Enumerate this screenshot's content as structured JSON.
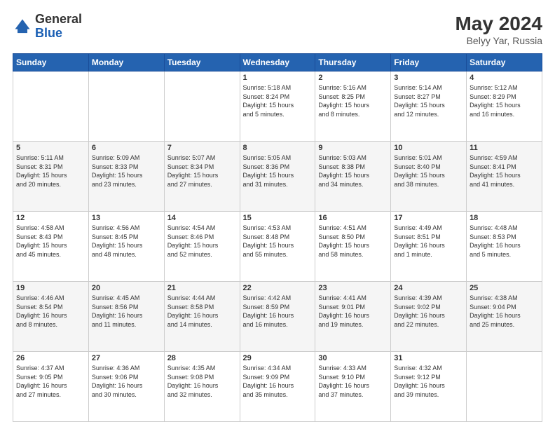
{
  "header": {
    "logo_general": "General",
    "logo_blue": "Blue",
    "month_year": "May 2024",
    "location": "Belyy Yar, Russia"
  },
  "days_of_week": [
    "Sunday",
    "Monday",
    "Tuesday",
    "Wednesday",
    "Thursday",
    "Friday",
    "Saturday"
  ],
  "weeks": [
    [
      {
        "day": "",
        "info": ""
      },
      {
        "day": "",
        "info": ""
      },
      {
        "day": "",
        "info": ""
      },
      {
        "day": "1",
        "info": "Sunrise: 5:18 AM\nSunset: 8:24 PM\nDaylight: 15 hours\nand 5 minutes."
      },
      {
        "day": "2",
        "info": "Sunrise: 5:16 AM\nSunset: 8:25 PM\nDaylight: 15 hours\nand 8 minutes."
      },
      {
        "day": "3",
        "info": "Sunrise: 5:14 AM\nSunset: 8:27 PM\nDaylight: 15 hours\nand 12 minutes."
      },
      {
        "day": "4",
        "info": "Sunrise: 5:12 AM\nSunset: 8:29 PM\nDaylight: 15 hours\nand 16 minutes."
      }
    ],
    [
      {
        "day": "5",
        "info": "Sunrise: 5:11 AM\nSunset: 8:31 PM\nDaylight: 15 hours\nand 20 minutes."
      },
      {
        "day": "6",
        "info": "Sunrise: 5:09 AM\nSunset: 8:33 PM\nDaylight: 15 hours\nand 23 minutes."
      },
      {
        "day": "7",
        "info": "Sunrise: 5:07 AM\nSunset: 8:34 PM\nDaylight: 15 hours\nand 27 minutes."
      },
      {
        "day": "8",
        "info": "Sunrise: 5:05 AM\nSunset: 8:36 PM\nDaylight: 15 hours\nand 31 minutes."
      },
      {
        "day": "9",
        "info": "Sunrise: 5:03 AM\nSunset: 8:38 PM\nDaylight: 15 hours\nand 34 minutes."
      },
      {
        "day": "10",
        "info": "Sunrise: 5:01 AM\nSunset: 8:40 PM\nDaylight: 15 hours\nand 38 minutes."
      },
      {
        "day": "11",
        "info": "Sunrise: 4:59 AM\nSunset: 8:41 PM\nDaylight: 15 hours\nand 41 minutes."
      }
    ],
    [
      {
        "day": "12",
        "info": "Sunrise: 4:58 AM\nSunset: 8:43 PM\nDaylight: 15 hours\nand 45 minutes."
      },
      {
        "day": "13",
        "info": "Sunrise: 4:56 AM\nSunset: 8:45 PM\nDaylight: 15 hours\nand 48 minutes."
      },
      {
        "day": "14",
        "info": "Sunrise: 4:54 AM\nSunset: 8:46 PM\nDaylight: 15 hours\nand 52 minutes."
      },
      {
        "day": "15",
        "info": "Sunrise: 4:53 AM\nSunset: 8:48 PM\nDaylight: 15 hours\nand 55 minutes."
      },
      {
        "day": "16",
        "info": "Sunrise: 4:51 AM\nSunset: 8:50 PM\nDaylight: 15 hours\nand 58 minutes."
      },
      {
        "day": "17",
        "info": "Sunrise: 4:49 AM\nSunset: 8:51 PM\nDaylight: 16 hours\nand 1 minute."
      },
      {
        "day": "18",
        "info": "Sunrise: 4:48 AM\nSunset: 8:53 PM\nDaylight: 16 hours\nand 5 minutes."
      }
    ],
    [
      {
        "day": "19",
        "info": "Sunrise: 4:46 AM\nSunset: 8:54 PM\nDaylight: 16 hours\nand 8 minutes."
      },
      {
        "day": "20",
        "info": "Sunrise: 4:45 AM\nSunset: 8:56 PM\nDaylight: 16 hours\nand 11 minutes."
      },
      {
        "day": "21",
        "info": "Sunrise: 4:44 AM\nSunset: 8:58 PM\nDaylight: 16 hours\nand 14 minutes."
      },
      {
        "day": "22",
        "info": "Sunrise: 4:42 AM\nSunset: 8:59 PM\nDaylight: 16 hours\nand 16 minutes."
      },
      {
        "day": "23",
        "info": "Sunrise: 4:41 AM\nSunset: 9:01 PM\nDaylight: 16 hours\nand 19 minutes."
      },
      {
        "day": "24",
        "info": "Sunrise: 4:39 AM\nSunset: 9:02 PM\nDaylight: 16 hours\nand 22 minutes."
      },
      {
        "day": "25",
        "info": "Sunrise: 4:38 AM\nSunset: 9:04 PM\nDaylight: 16 hours\nand 25 minutes."
      }
    ],
    [
      {
        "day": "26",
        "info": "Sunrise: 4:37 AM\nSunset: 9:05 PM\nDaylight: 16 hours\nand 27 minutes."
      },
      {
        "day": "27",
        "info": "Sunrise: 4:36 AM\nSunset: 9:06 PM\nDaylight: 16 hours\nand 30 minutes."
      },
      {
        "day": "28",
        "info": "Sunrise: 4:35 AM\nSunset: 9:08 PM\nDaylight: 16 hours\nand 32 minutes."
      },
      {
        "day": "29",
        "info": "Sunrise: 4:34 AM\nSunset: 9:09 PM\nDaylight: 16 hours\nand 35 minutes."
      },
      {
        "day": "30",
        "info": "Sunrise: 4:33 AM\nSunset: 9:10 PM\nDaylight: 16 hours\nand 37 minutes."
      },
      {
        "day": "31",
        "info": "Sunrise: 4:32 AM\nSunset: 9:12 PM\nDaylight: 16 hours\nand 39 minutes."
      },
      {
        "day": "",
        "info": ""
      }
    ]
  ]
}
